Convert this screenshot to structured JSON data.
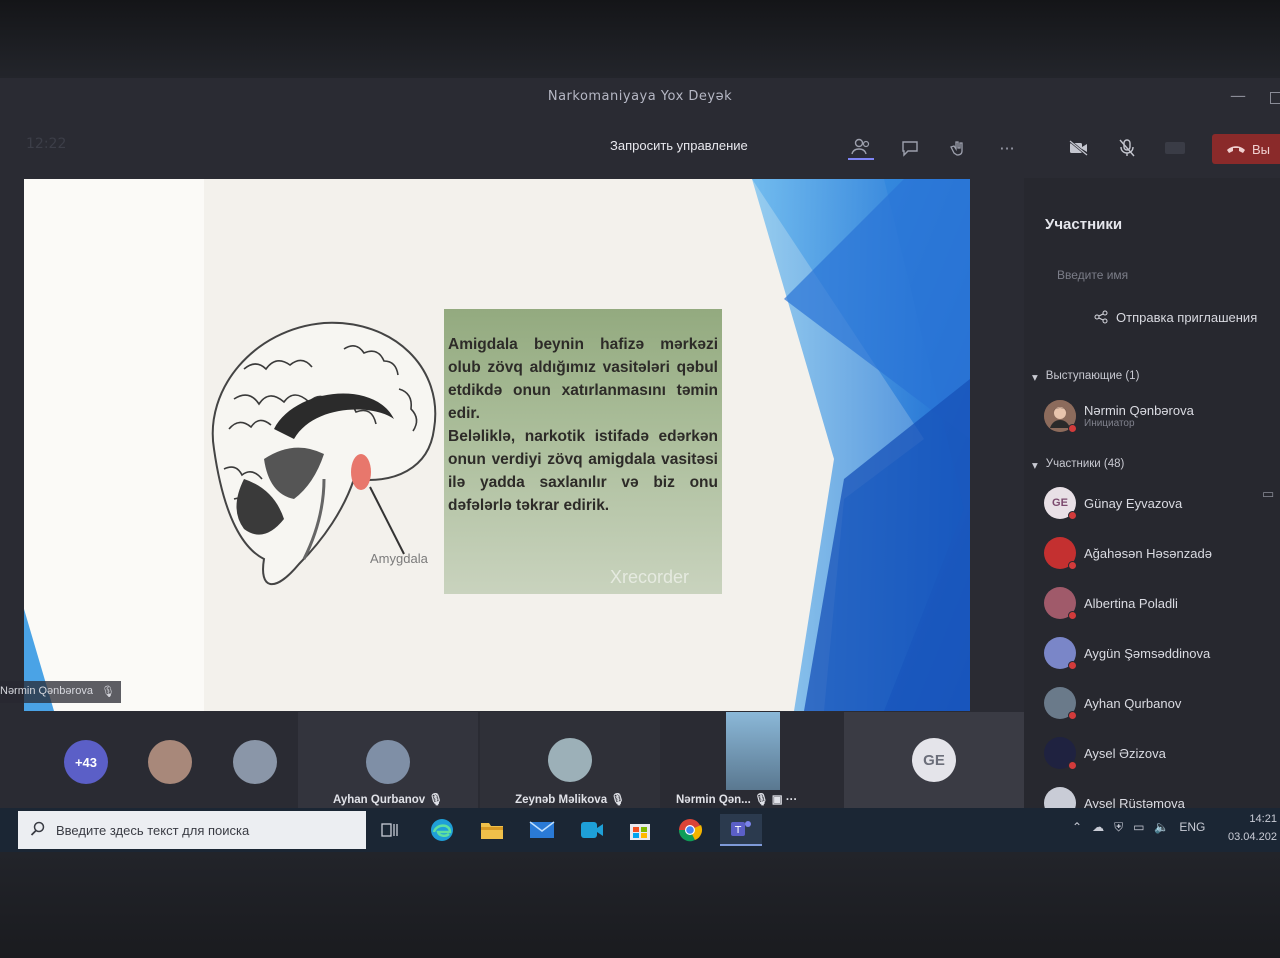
{
  "window": {
    "title": "Narkomaniyaya Yox Deyək",
    "minimize_glyph": "—"
  },
  "toolbar": {
    "timer": "12:22",
    "request_control": "Запросить управление",
    "leave_label": "Вы",
    "icons": [
      "participants-icon",
      "chat-icon",
      "reactions-icon",
      "more-icon",
      "camera-off-icon",
      "mic-off-icon",
      "share-tray-icon",
      "hangup-icon"
    ],
    "more_glyph": "···"
  },
  "slide": {
    "paragraph1": "Amigdala beynin hafizə mərkəzi olub zövq aldığımız vasitələri qəbul etdikdə onun xatırlanmasını təmin edir.",
    "paragraph2": "Beləliklə, narkotik istifadə edərkən onun verdiyi zövq amigdala vasitəsi ilə yadda saxlanılır və biz onu dəfələrlə təkrar edirik.",
    "image_label": "Amygdala",
    "watermark": "Xrecorder",
    "presenter_tag": "Nərmin Qənbərova"
  },
  "panel": {
    "title": "Участники",
    "search_placeholder": "Введите имя",
    "invite_label": "Отправка приглашения",
    "presenters_header": "Выступающие (1)",
    "presenter": {
      "name": "Nərmin Qənbərova",
      "role": "Инициатор"
    },
    "attendees_header": "Участники (48)",
    "attendees": [
      {
        "name": "Günay Eyvazova",
        "initials": "GE"
      },
      {
        "name": "Ağahəsən Həsənzadə",
        "initials": ""
      },
      {
        "name": "Albertina Poladli",
        "initials": ""
      },
      {
        "name": "Aygün Şəmsəddinova",
        "initials": ""
      },
      {
        "name": "Ayhan Qurbanov",
        "initials": ""
      },
      {
        "name": "Aysel Əzizova",
        "initials": ""
      },
      {
        "name": "Aysel Rüstəmova",
        "initials": ""
      }
    ]
  },
  "tiles": {
    "overflow_count": "+43",
    "tile1_name": "Ayhan Qurbanov",
    "tile2_name": "Zeynəb Məlikova",
    "tile3_name": "Nərmin Qən...",
    "tile4_initials": "GE"
  },
  "taskbar": {
    "search_placeholder": "Введите здесь текст для поиска",
    "language": "ENG",
    "time": "14:21",
    "date": "03.04.202"
  },
  "colors": {
    "accent": "#7f85f5",
    "leave": "#8a2a2a",
    "taskbar": "#1b2634",
    "slide_blue": "#1e6fd6"
  }
}
